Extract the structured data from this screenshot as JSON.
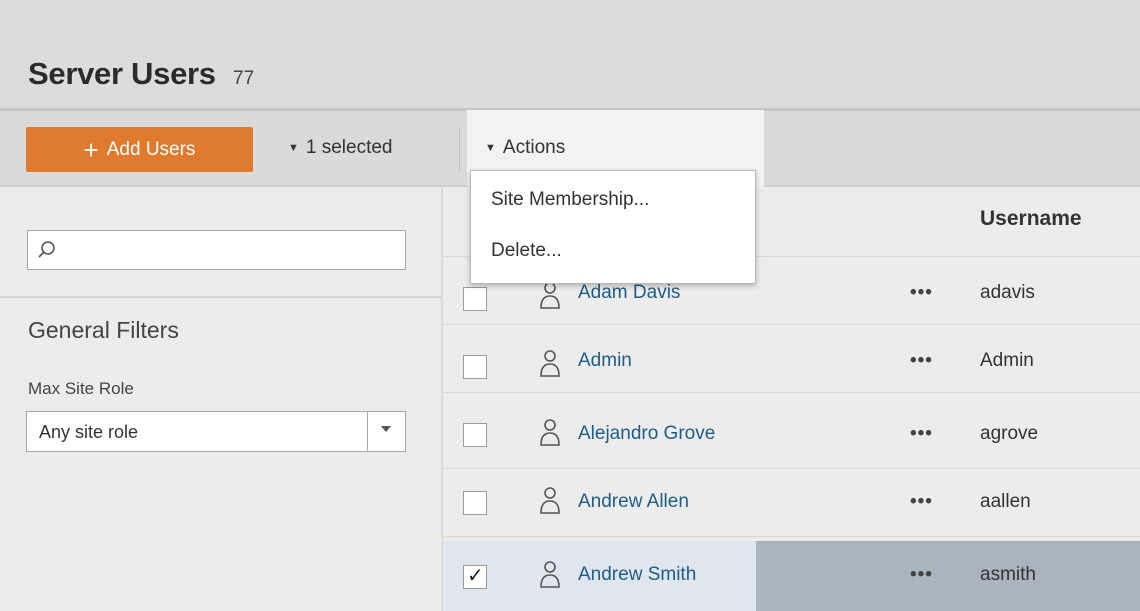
{
  "header": {
    "title": "Server Users",
    "count": "77"
  },
  "toolbar": {
    "add_users_icon": "plus-icon",
    "add_users_label": "Add Users",
    "selected_label": "1 selected",
    "actions_label": "Actions"
  },
  "actions_menu": {
    "items": [
      "Site Membership...",
      "Delete..."
    ]
  },
  "sidebar": {
    "search": {
      "placeholder": "",
      "value": "",
      "icon": "search-icon"
    },
    "filters_title": "General Filters",
    "max_site_role_label": "Max Site Role",
    "max_site_role_value": "Any site role"
  },
  "table": {
    "columns": {
      "username": "Username"
    },
    "rows": [
      {
        "display_name": "Adam Davis",
        "more": "•••",
        "username": "adavis",
        "checked": false
      },
      {
        "display_name": "Admin",
        "more": "•••",
        "username": "Admin",
        "checked": false
      },
      {
        "display_name": "Alejandro Grove",
        "more": "•••",
        "username": "agrove",
        "checked": false
      },
      {
        "display_name": "Andrew Allen",
        "more": "•••",
        "username": "aallen",
        "checked": false
      },
      {
        "display_name": "Andrew Smith",
        "more": "•••",
        "username": "asmith",
        "checked": true
      }
    ]
  },
  "colors": {
    "accent": "#e07a2e",
    "link": "#1f5d86",
    "selected_row_light": "#dfe6ee",
    "selected_row_dark": "#aab4bf"
  }
}
